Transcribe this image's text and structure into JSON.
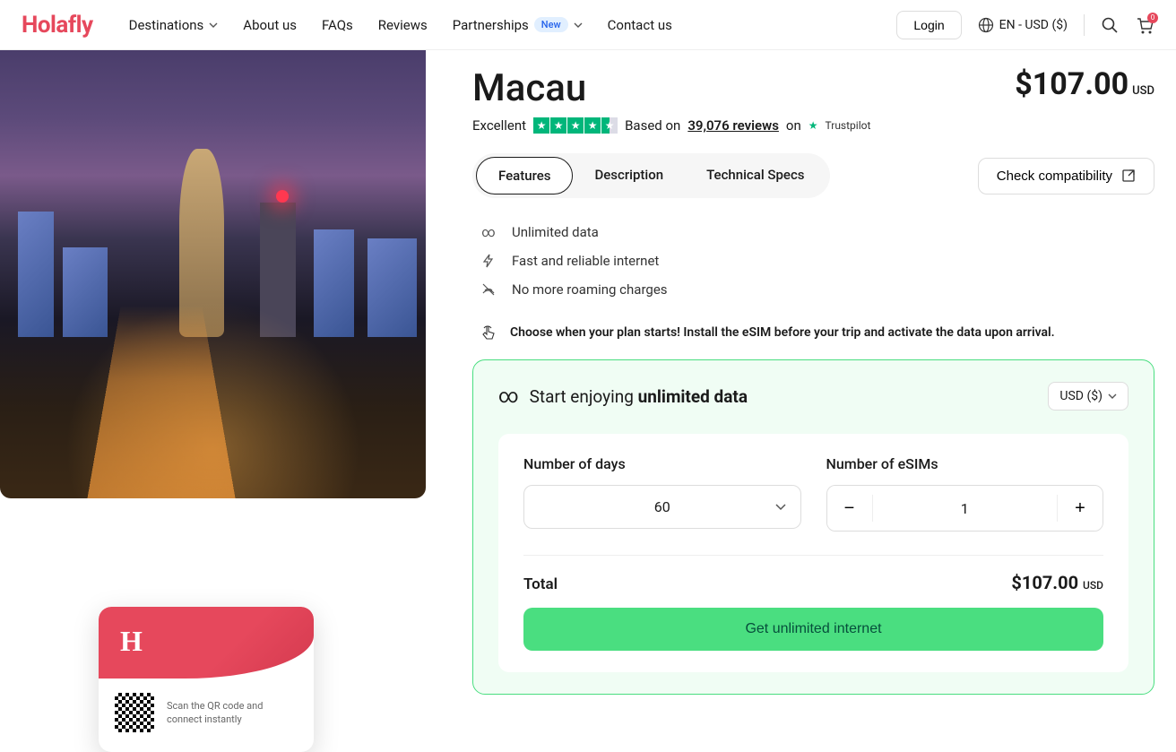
{
  "header": {
    "brand": "Holafly",
    "nav": {
      "destinations": "Destinations",
      "about": "About us",
      "faqs": "FAQs",
      "reviews": "Reviews",
      "partnerships": "Partnerships",
      "partnerships_badge": "New",
      "contact": "Contact us"
    },
    "login": "Login",
    "locale": "EN - USD ($)",
    "cart_count": "0"
  },
  "product": {
    "title": "Macau",
    "price": "$107.00",
    "currency": "USD",
    "rating_label": "Excellent",
    "reviews_based": "Based on",
    "reviews_count": "39,076 reviews",
    "reviews_on": "on",
    "trustpilot": "Trustpilot"
  },
  "tabs": {
    "features": "Features",
    "description": "Description",
    "tech": "Technical Specs",
    "compat": "Check compatibility"
  },
  "features": {
    "f1": "Unlimited data",
    "f2": "Fast and reliable internet",
    "f3": "No more roaming charges"
  },
  "plan_note": "Choose when your plan starts! Install the eSIM before your trip and activate the data upon arrival.",
  "order": {
    "title_prefix": "Start enjoying ",
    "title_bold": "unlimited data",
    "currency_sel": "USD ($)",
    "days_label": "Number of days",
    "days_value": "60",
    "esims_label": "Number of eSIMs",
    "esims_value": "1",
    "total_label": "Total",
    "total_price": "$107.00",
    "total_currency": "USD",
    "cta": "Get unlimited internet"
  },
  "sim": {
    "text": "Scan the QR code and connect instantly"
  }
}
